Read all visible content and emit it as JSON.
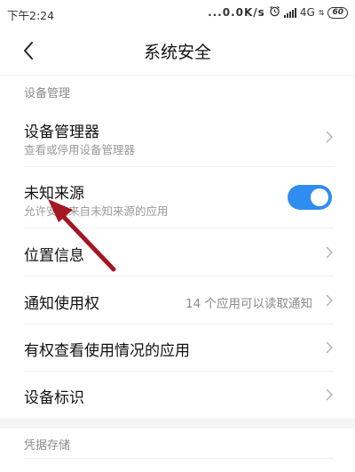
{
  "status_bar": {
    "time": "下午2:24",
    "network_speed": "...0.0K/s",
    "network_type": "4G",
    "battery": "60"
  },
  "header": {
    "title": "系统安全"
  },
  "sections": {
    "device_management": "设备管理",
    "credential_storage": "凭据存储"
  },
  "rows": {
    "device_admin": {
      "title": "设备管理器",
      "subtitle": "查看或停用设备管理器"
    },
    "unknown_sources": {
      "title": "未知来源",
      "subtitle": "允许安装来自未知来源的应用",
      "toggle_on": true
    },
    "location_info": {
      "title": "位置信息"
    },
    "notification_access": {
      "title": "通知使用权",
      "value": "14 个应用可以读取通知"
    },
    "usage_access": {
      "title": "有权查看使用情况的应用"
    },
    "device_id": {
      "title": "设备标识"
    }
  },
  "colors": {
    "accent": "#2f8cf0",
    "annotation_arrow": "#a31622"
  },
  "icons": {
    "back": "back-arrow-icon",
    "chevron": "chevron-right-icon",
    "alarm": "alarm-icon",
    "signal": "signal-icon",
    "battery": "battery-icon"
  }
}
